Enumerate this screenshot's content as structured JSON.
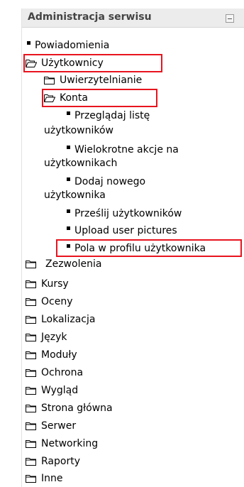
{
  "block": {
    "title": "Administracja serwisu",
    "collapse_icon": "minus-box-icon"
  },
  "tree": {
    "powiadomienia": "Powiadomienia",
    "uzytkownicy": "Użytkownicy",
    "uwierzytelnianie": "Uwierzytelnianie",
    "konta": "Konta",
    "przegladaj_1": "Przeglądaj listę",
    "przegladaj_2": "użytkowników",
    "wielokrotne_1": "Wielokrotne akcje na",
    "wielokrotne_2": "użytkownikach",
    "dodaj_1": "Dodaj nowego",
    "dodaj_2": "użytkownika",
    "przeslij": "Prześlij użytkowników",
    "upload_pictures": "Upload user pictures",
    "pola_profilu": "Pola w profilu użytkownika",
    "zezwolenia": "Zezwolenia",
    "kursy": "Kursy",
    "oceny": "Oceny",
    "lokalizacja": "Lokalizacja",
    "jezyk": "Język",
    "moduly": "Moduły",
    "ochrona": "Ochrona",
    "wyglad": "Wygląd",
    "strona_glowna": "Strona główna",
    "serwer": "Serwer",
    "networking": "Networking",
    "raporty": "Raporty",
    "inne": "Inne"
  },
  "colors": {
    "highlight_border": "#e8141e",
    "header_bg": "#ececec"
  }
}
